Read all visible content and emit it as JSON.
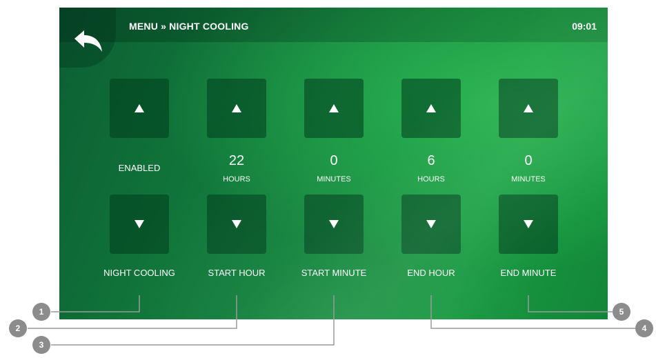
{
  "header": {
    "breadcrumb": "MENU » NIGHT COOLING",
    "time": "09:01"
  },
  "controls": [
    {
      "name": "night-cooling",
      "value": "ENABLED",
      "unit": "",
      "label": "NIGHT COOLING"
    },
    {
      "name": "start-hour",
      "value": "22",
      "unit": "HOURS",
      "label": "START HOUR"
    },
    {
      "name": "start-minute",
      "value": "0",
      "unit": "MINUTES",
      "label": "START MINUTE"
    },
    {
      "name": "end-hour",
      "value": "6",
      "unit": "HOURS",
      "label": "END HOUR"
    },
    {
      "name": "end-minute",
      "value": "0",
      "unit": "MINUTES",
      "label": "END MINUTE"
    }
  ],
  "callouts": [
    "1",
    "2",
    "3",
    "4",
    "5"
  ],
  "icons": {
    "back": "back-arrow-icon",
    "up": "triangle-up-icon",
    "down": "triangle-down-icon"
  }
}
